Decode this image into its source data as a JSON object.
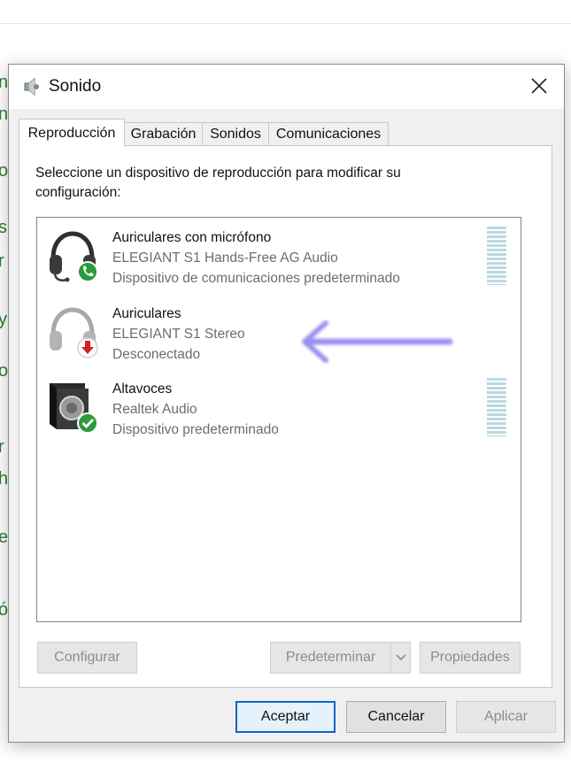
{
  "window": {
    "title": "Sonido",
    "icon": "speaker-icon",
    "close_icon": "close-icon"
  },
  "background": {
    "letters": [
      "n",
      "n",
      "o",
      "s",
      "r",
      "y",
      "o",
      "r",
      "h",
      "e",
      "ó"
    ]
  },
  "tabs": [
    {
      "label": "Reproducción",
      "active": true
    },
    {
      "label": "Grabación",
      "active": false
    },
    {
      "label": "Sonidos",
      "active": false
    },
    {
      "label": "Comunicaciones",
      "active": false
    }
  ],
  "panel": {
    "instruction": "Seleccione un dispositivo de reproducción para modificar su configuración:"
  },
  "devices": [
    {
      "name": "Auriculares con micrófono",
      "driver": "ELEGIANT S1 Hands-Free AG Audio",
      "status": "Dispositivo de comunicaciones predeterminado",
      "icon": "headset-icon",
      "badge": "phone-badge-icon",
      "badge_color": "#2b9a3c"
    },
    {
      "name": "Auriculares",
      "driver": "ELEGIANT S1 Stereo",
      "status": "Desconectado",
      "icon": "headphones-icon",
      "badge": "disconnected-badge-icon",
      "badge_color": "#d42020"
    },
    {
      "name": "Altavoces",
      "driver": "Realtek Audio",
      "status": "Dispositivo predeterminado",
      "icon": "speaker-device-icon",
      "badge": "check-badge-icon",
      "badge_color": "#2b9a3c"
    }
  ],
  "annotation": {
    "icon": "arrow-left-icon",
    "color": "#8a7cf0"
  },
  "buttons": {
    "configure": "Configurar",
    "set_default": "Predeterminar",
    "properties": "Propiedades",
    "ok": "Aceptar",
    "cancel": "Cancelar",
    "apply": "Aplicar"
  }
}
